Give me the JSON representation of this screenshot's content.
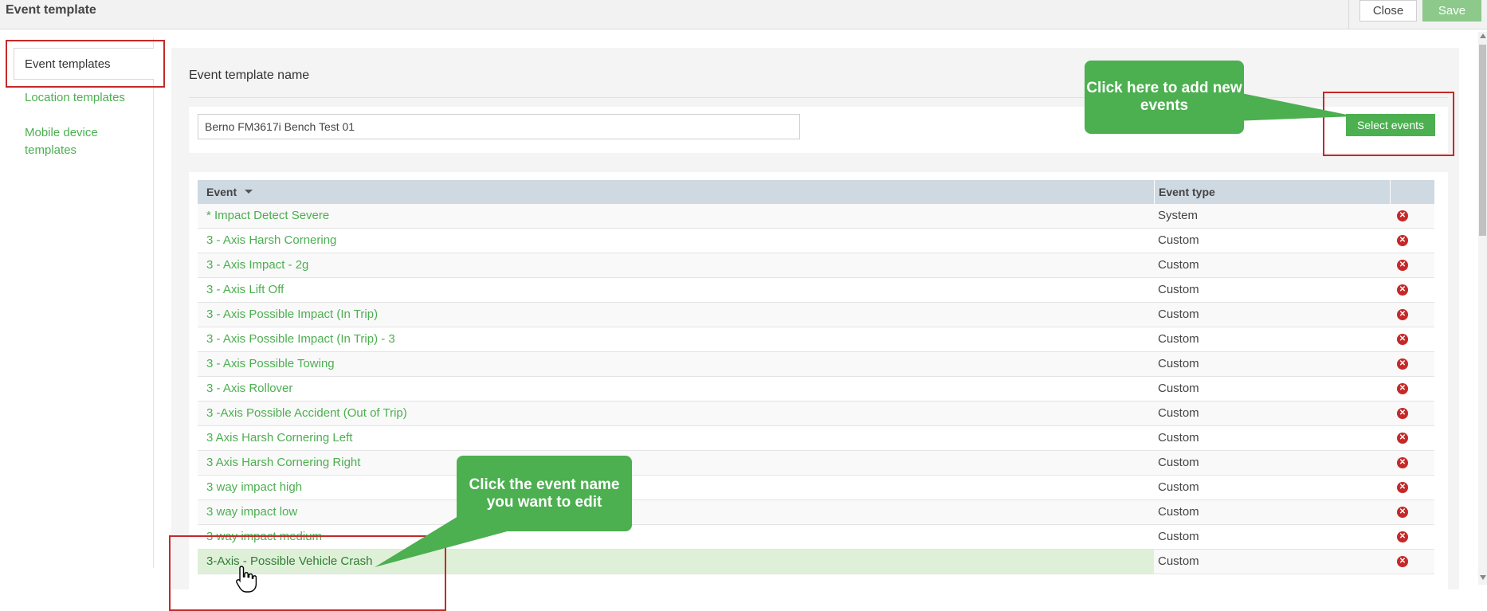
{
  "window": {
    "title": "Event template"
  },
  "toolbar": {
    "close_label": "Close",
    "save_label": "Save"
  },
  "sidebar": {
    "items": [
      {
        "label": "Event templates",
        "active": true
      },
      {
        "label": "Location templates"
      },
      {
        "label": "Mobile device templates"
      }
    ]
  },
  "main": {
    "section_title": "Event template name",
    "name_value": "Berno FM3617i Bench Test 01",
    "select_events_label": "Select events"
  },
  "table": {
    "headers": {
      "event": "Event",
      "event_type": "Event type"
    },
    "rows": [
      {
        "event": "* Impact Detect Severe",
        "type": "System"
      },
      {
        "event": "3 - Axis Harsh Cornering",
        "type": "Custom"
      },
      {
        "event": "3 - Axis Impact - 2g",
        "type": "Custom"
      },
      {
        "event": "3 - Axis Lift Off",
        "type": "Custom"
      },
      {
        "event": "3 - Axis Possible Impact (In Trip)",
        "type": "Custom"
      },
      {
        "event": "3 - Axis Possible Impact (In Trip) - 3",
        "type": "Custom"
      },
      {
        "event": "3 - Axis Possible Towing",
        "type": "Custom"
      },
      {
        "event": "3 - Axis Rollover",
        "type": "Custom"
      },
      {
        "event": "3 -Axis Possible Accident (Out of Trip)",
        "type": "Custom"
      },
      {
        "event": "3 Axis Harsh Cornering Left",
        "type": "Custom"
      },
      {
        "event": "3 Axis Harsh Cornering Right",
        "type": "Custom"
      },
      {
        "event": "3 way impact high",
        "type": "Custom"
      },
      {
        "event": "3 way impact low",
        "type": "Custom"
      },
      {
        "event": "3 way impact medium",
        "type": "Custom"
      },
      {
        "event": "3-Axis - Possible Vehicle Crash",
        "type": "Custom",
        "selected": true
      }
    ]
  },
  "annotations": {
    "add_events_callout": "Click here to add new events",
    "edit_event_callout": "Click the event name you want to edit"
  },
  "colors": {
    "accent_green": "#4caf50",
    "highlight_red": "#c62828",
    "selected_row": "#dff0d8",
    "header_blue": "#ced9e2"
  }
}
